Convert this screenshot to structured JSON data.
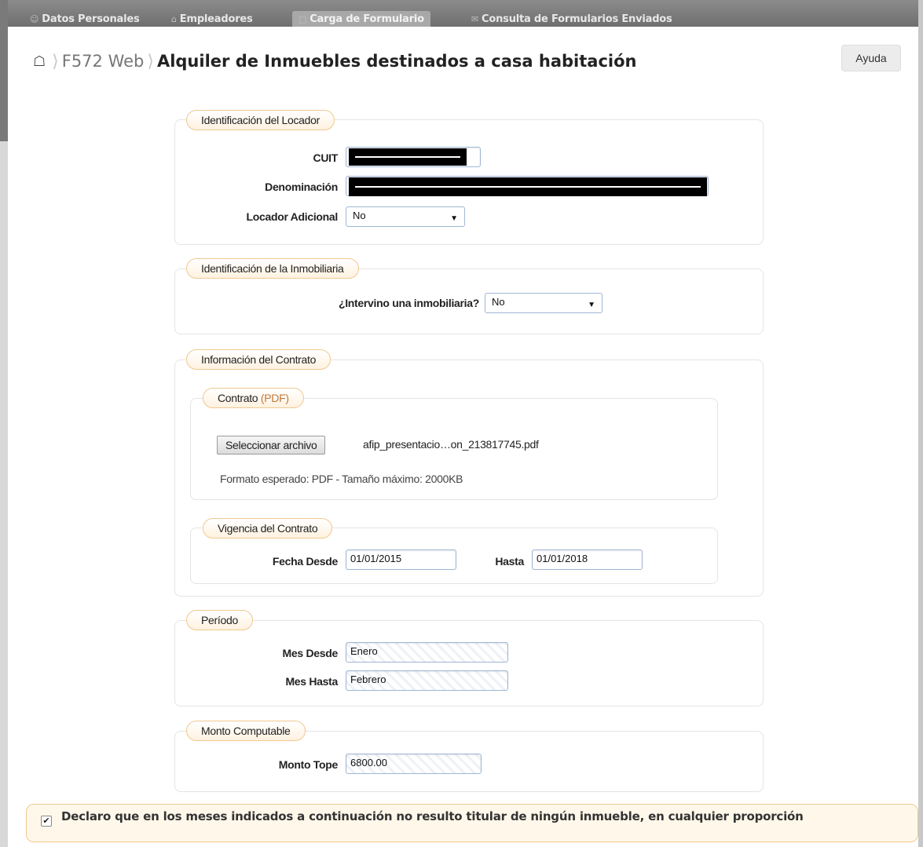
{
  "nav": {
    "tabs": [
      {
        "icon": "user-icon",
        "label": "Datos Personales"
      },
      {
        "icon": "building-icon",
        "label": "Empleadores"
      },
      {
        "icon": "document-icon",
        "label": "Carga de Formulario"
      },
      {
        "icon": "envelope-icon",
        "label": "Consulta de Formularios Enviados"
      }
    ],
    "active_tab": "Carga de Formulario"
  },
  "header": {
    "breadcrumb": "F572 Web",
    "title": "Alquiler de Inmuebles destinados a casa habitación",
    "help_label": "Ayuda"
  },
  "locador": {
    "legend": "Identificación del Locador",
    "cuit_label": "CUIT",
    "denominacion_label": "Denominación",
    "adicional_label": "Locador Adicional",
    "adicional_value": "No"
  },
  "inmobiliaria": {
    "legend": "Identificación de la Inmobiliaria",
    "question_label": "¿Intervino una inmobiliaria?",
    "question_value": "No"
  },
  "contrato": {
    "legend": "Información del Contrato",
    "file_legend_main": "Contrato",
    "file_legend_pdf": "(PDF)",
    "file_button": "Seleccionar archivo",
    "file_name": "afip_presentacio…on_213817745.pdf",
    "file_hint": "Formato esperado: PDF - Tamaño máximo: 2000KB",
    "vigencia_legend": "Vigencia del Contrato",
    "desde_label": "Fecha Desde",
    "desde_value": "01/01/2015",
    "hasta_label": "Hasta",
    "hasta_value": "01/01/2018"
  },
  "periodo": {
    "legend": "Período",
    "mes_desde_label": "Mes Desde",
    "mes_desde_value": "Enero",
    "mes_hasta_label": "Mes Hasta",
    "mes_hasta_value": "Febrero"
  },
  "monto": {
    "legend": "Monto Computable",
    "tope_label": "Monto Tope",
    "tope_value": "6800.00"
  },
  "declaracion": {
    "checked": true,
    "text": "Declaro que en los meses indicados a continuación no resulto titular de ningún inmueble, en cualquier proporción"
  }
}
